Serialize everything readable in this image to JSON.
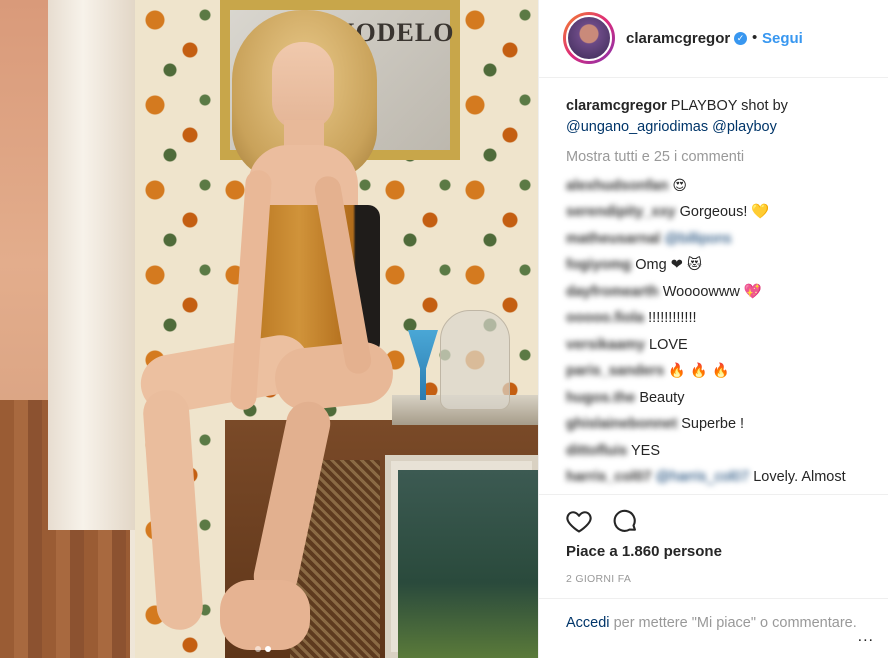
{
  "photo": {
    "mirror_sign_text": "MODELO",
    "carousel": {
      "total": 2,
      "active": 2
    }
  },
  "header": {
    "username": "claramcgregor",
    "verified_icon": "verified-badge-icon",
    "separator": "•",
    "follow_label": "Segui"
  },
  "caption": {
    "username": "claramcgregor",
    "text": "PLAYBOY shot by",
    "mentions": [
      "@ungano_agriodimas",
      "@playboy"
    ]
  },
  "view_all_comments": "Mostra tutti e 25 i commenti",
  "comments": [
    {
      "user": "alexhudsonfan",
      "text": "😍"
    },
    {
      "user": "serendipity_xxy",
      "text": "Gorgeous! 💛"
    },
    {
      "user": "matheusarnal",
      "mention": "@billipons",
      "text": ""
    },
    {
      "user": "fogiyomg",
      "text": "Omg ❤ 😻"
    },
    {
      "user": "dayfromearth",
      "text": "Woooowww 💖"
    },
    {
      "user": "ooooo.fiola",
      "text": "!!!!!!!!!!!!"
    },
    {
      "user": "versikaamy",
      "text": "LOVE"
    },
    {
      "user": "paris_sanders",
      "text": "🔥 🔥 🔥"
    },
    {
      "user": "hugos.the",
      "text": "Beauty"
    },
    {
      "user": "ghislainebonnet",
      "text": "Superbe !"
    },
    {
      "user": "dittofluis",
      "text": "YES"
    },
    {
      "user": "harris_col07",
      "mention": "@harris_col07",
      "text": "Lovely. Almost"
    }
  ],
  "actions": {
    "like_icon": "heart-icon",
    "comment_icon": "speech-bubble-icon"
  },
  "likes": "Piace a 1.860 persone",
  "date": "2 GIORNI FA",
  "footer": {
    "login_label": "Accedi",
    "rest": "per mettere \"Mi piace\" o commentare."
  },
  "more_label": "...",
  "colors": {
    "link_blue": "#3897f0",
    "dark_link": "#003569",
    "muted": "#999999",
    "text": "#262626"
  }
}
